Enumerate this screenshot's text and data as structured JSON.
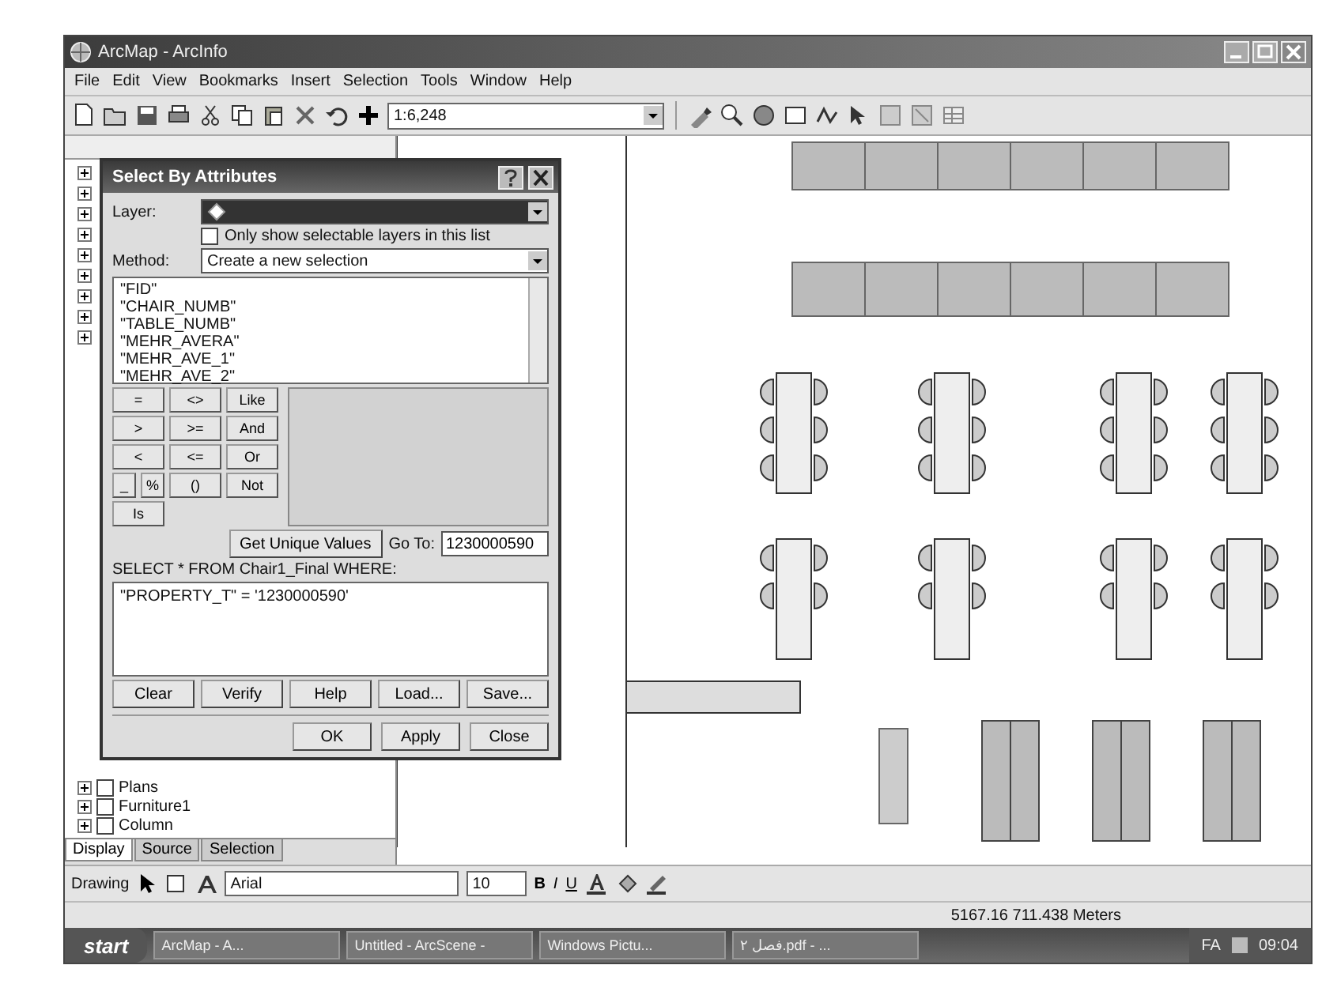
{
  "window": {
    "title": "ArcMap - ArcInfo"
  },
  "menu": [
    "File",
    "Edit",
    "View",
    "Bookmarks",
    "Insert",
    "Selection",
    "Tools",
    "Window",
    "Help"
  ],
  "toolbar": {
    "scale": "1:6,248"
  },
  "toc": {
    "items": [
      {
        "label": "Plans",
        "checked": false
      },
      {
        "label": "Furniture1",
        "checked": false
      },
      {
        "label": "Column",
        "checked": false
      }
    ],
    "tabs": [
      {
        "label": "Display",
        "selected": true
      },
      {
        "label": "Source",
        "selected": false
      },
      {
        "label": "Selection",
        "selected": false
      }
    ]
  },
  "dialog": {
    "title": "Select By Attributes",
    "layer_label": "Layer:",
    "only_selectable": {
      "label": "Only show selectable layers in this list",
      "checked": false
    },
    "method_label": "Method:",
    "method": "Create a new selection",
    "fields": [
      "\"FID\"",
      "\"CHAIR_NUMB\"",
      "\"TABLE_NUMB\"",
      "\"MEHR_AVERA\"",
      "\"MEHR_AVE_1\"",
      "\"MEHR_AVE_2\""
    ],
    "operators": [
      {
        "label": "=",
        "kind": "full"
      },
      {
        "label": "<>",
        "kind": "full"
      },
      {
        "label": "Like",
        "kind": "full"
      },
      {
        "label": ">",
        "kind": "full"
      },
      {
        "label": ">=",
        "kind": "full"
      },
      {
        "label": "And",
        "kind": "full"
      },
      {
        "label": "<",
        "kind": "full"
      },
      {
        "label": "<=",
        "kind": "full"
      },
      {
        "label": "Or",
        "kind": "full"
      },
      {
        "label": "_",
        "kind": "half"
      },
      {
        "label": "%",
        "kind": "half"
      },
      {
        "label": "()",
        "kind": "full"
      },
      {
        "label": "Not",
        "kind": "full"
      },
      {
        "label": "Is",
        "kind": "full"
      }
    ],
    "unique_button": "Get Unique Values",
    "goto_label": "Go To:",
    "goto_value": "1230000590",
    "sql_label": "SELECT * FROM Chair1_Final WHERE:",
    "expression": "\"PROPERTY_T\" = '1230000590'",
    "buttons": [
      "Clear",
      "Verify",
      "Help",
      "Load...",
      "Save..."
    ],
    "footer_buttons": [
      "OK",
      "Apply",
      "Close"
    ]
  },
  "drawing_toolbar": {
    "label": "Drawing",
    "font": "Arial",
    "size": "10",
    "styles": [
      "B",
      "I",
      "U"
    ]
  },
  "status": "5167.16  711.438 Meters",
  "taskbar": {
    "start": "start",
    "tasks": [
      "ArcMap - A...",
      "Untitled - ArcScene -",
      "Windows Pictu...",
      "فصل ۲.pdf - ..."
    ],
    "lang": "FA",
    "clock": "09:04"
  }
}
